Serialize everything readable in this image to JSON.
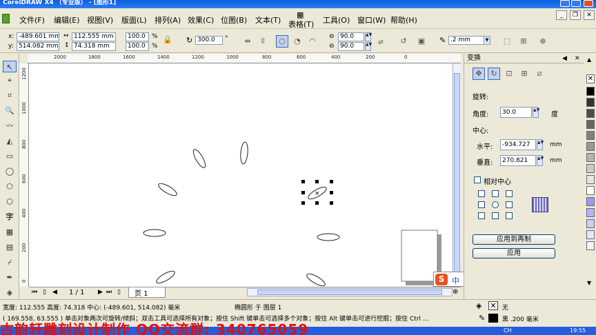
{
  "window": {
    "title": "CorelDRAW X4 （专业版） - [图形1]"
  },
  "menu": {
    "items": [
      "文件(F)",
      "编辑(E)",
      "视图(V)",
      "版面(L)",
      "排列(A)",
      "效果(C)",
      "位图(B)",
      "文本(T)",
      "表格(T)",
      "工具(O)",
      "窗口(W)",
      "帮助(H)"
    ]
  },
  "propbar": {
    "x_label": "x:",
    "x_value": "-489.601 mm",
    "y_label": "y:",
    "y_value": "514.082 mm",
    "width_value": "112.555 mm",
    "height_value": "74.318 mm",
    "scale_x": "100.0",
    "scale_y": "100.0",
    "percent": "%",
    "rotation": "300.0",
    "degree": "°",
    "start_angle": "90.0",
    "end_angle": "90.0",
    "outline_width": ".2 mm"
  },
  "ruler": {
    "h_ticks": [
      "2000",
      "1800",
      "1600",
      "1400",
      "1200",
      "1000",
      "800",
      "600",
      "400",
      "200",
      "0"
    ],
    "v_ticks": [
      "1200",
      "1000",
      "800",
      "600",
      "400",
      "200",
      "0"
    ]
  },
  "pagenav": {
    "counter": "1 / 1",
    "page_tab": "页 1"
  },
  "docker": {
    "title": "变换",
    "section": "旋转:",
    "angle_label": "角度:",
    "angle_value": "30.0",
    "angle_unit": "度",
    "center_label": "中心:",
    "h_label": "水平:",
    "h_value": "-934.727",
    "v_label": "垂直:",
    "v_value": "270.821",
    "unit": "mm",
    "relative_center": "相对中心",
    "apply_copy": "应用到再制",
    "apply": "应用"
  },
  "ime": {
    "label": "中"
  },
  "status": {
    "line1": "宽度: 112.555  高度: 74.318  中心: (-489.601, 514.082)  毫米",
    "object_info": "椭圆形 于 图层 1",
    "line2": "( 169.558, 63.555 )      单击对象两次可旋转/倾斜；双击工具可选择所有对象；按住 Shift 键单击可选择多个对象；按住 Alt 键单击可进行挖掘；按住 Ctrl ...",
    "fill_label": "无",
    "outline_label": "黑  .200 毫米",
    "watermark": "古韵轩雕刻设计制作 QQ交流群: 340765059",
    "clock": "19:55",
    "lang": "CH"
  },
  "palette": [
    "#000000",
    "#333333",
    "#4d4d4d",
    "#666666",
    "#808080",
    "#999999",
    "#b3b3b3",
    "#cccccc",
    "#e5e5e5",
    "#ffffff"
  ]
}
